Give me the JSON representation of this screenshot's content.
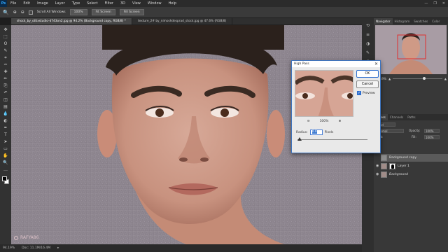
{
  "menu": {
    "logo": "Ps",
    "items": [
      "File",
      "Edit",
      "Image",
      "Layer",
      "Type",
      "Select",
      "Filter",
      "3D",
      "View",
      "Window",
      "Help"
    ],
    "window_controls": [
      "—",
      "❐",
      "✕"
    ]
  },
  "options": {
    "scroll_all_label": "Scroll All Windows",
    "zoom_value": "100%",
    "fit_screen_label": "Fit Screen",
    "fill_screen_label": "Fill Screen"
  },
  "tabs": [
    {
      "label": "shock_by_ottixstudio-d743on2.jpg @ 94.2% (Background copy, RGB/8) *"
    },
    {
      "label": "texture_2# by_nimoshdesprad_stock.jpg @ 47.6% (RGB/8)"
    }
  ],
  "toolbar": {
    "tools": [
      "move-tool-icon",
      "marquee-tool-icon",
      "lasso-tool-icon",
      "quick-select-tool-icon",
      "crop-tool-icon",
      "eyedropper-tool-icon",
      "healing-brush-tool-icon",
      "brush-tool-icon",
      "clone-stamp-tool-icon",
      "history-brush-tool-icon",
      "eraser-tool-icon",
      "gradient-tool-icon",
      "blur-tool-icon",
      "dodge-tool-icon",
      "pen-tool-icon",
      "type-tool-icon",
      "path-select-tool-icon",
      "rectangle-tool-icon",
      "hand-tool-icon",
      "zoom-tool-icon",
      "more-tools-icon"
    ],
    "glyphs": [
      "✥",
      "⬚",
      "ʘ",
      "✎",
      "⌗",
      "✑",
      "✚",
      "✏",
      "⎘",
      "↶",
      "◫",
      "▤",
      "💧",
      "◐",
      "✒",
      "T",
      "➤",
      "▭",
      "✋",
      "🔍",
      "…"
    ],
    "fg_color": "#000000",
    "bg_color": "#ffffff"
  },
  "status": {
    "zoom": "94.19%",
    "doc": "Doc: 11.1M/16.4M"
  },
  "watermark": {
    "text": "RAFYA86"
  },
  "right_strip": {
    "icons": [
      "history-icon",
      "properties-icon",
      "adjustments-icon",
      "brushes-icon",
      "paragraph-icon",
      "character-icon",
      "libraries-icon"
    ],
    "glyphs": [
      "⟲",
      "≡",
      "◑",
      "✎",
      "¶",
      "A",
      "☰"
    ]
  },
  "navigator": {
    "tabs": [
      "Navigator",
      "Histogram",
      "Swatches",
      "Color"
    ],
    "zoom": "94.19%"
  },
  "layers": {
    "tabs": [
      "Layers",
      "Channels",
      "Paths"
    ],
    "kind_label": "Kind",
    "blend_mode": "Normal",
    "opacity_label": "Opacity:",
    "opacity_value": "100%",
    "lock_label": "Lock:",
    "fill_label": "Fill:",
    "fill_value": "100%",
    "items": [
      {
        "name": "Background copy",
        "selected": true
      },
      {
        "name": "Layer 1",
        "selected": false
      },
      {
        "name": "Background",
        "selected": false
      }
    ]
  },
  "dialog": {
    "title": "High Pass",
    "close_glyph": "✕",
    "ok_label": "OK",
    "cancel_label": "Cancel",
    "preview_label": "Preview",
    "preview_checked": true,
    "zoom_out_glyph": "⊖",
    "zoom_in_glyph": "⊕",
    "zoom_value": "100%",
    "radius_label": "Radius:",
    "radius_value": "0.0",
    "radius_unit": "Pixels",
    "accent": "#2f6fcf"
  }
}
